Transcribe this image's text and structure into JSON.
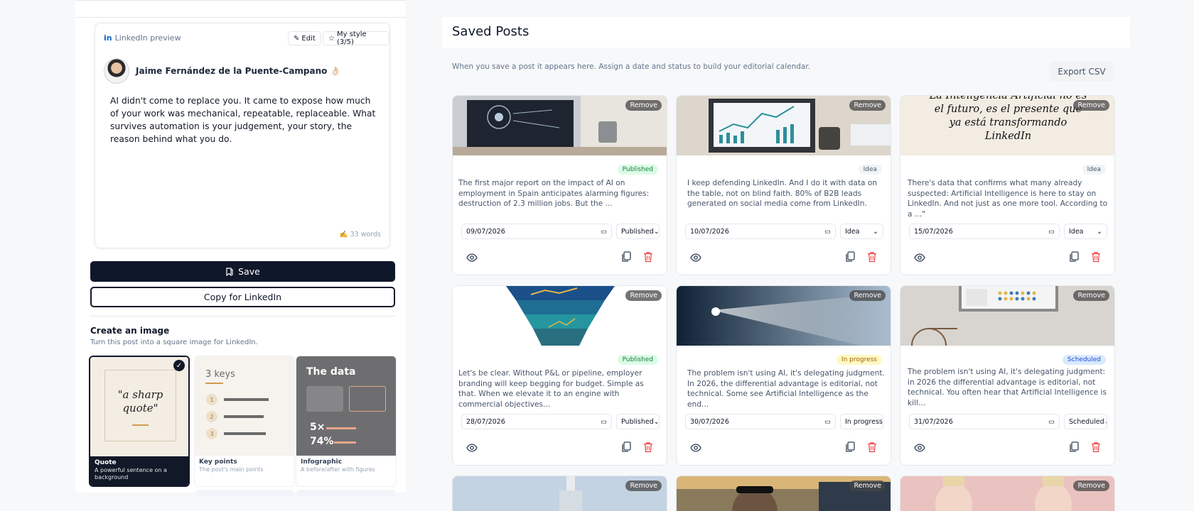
{
  "preview": {
    "header": "LinkedIn preview",
    "edit_label": "Edit",
    "style_label": "My style (3/5)",
    "author": "Jaime Fernández de la Puente-Campano 👌🏻",
    "text": "AI didn't come to replace you. It came to expose how much of your work was mechanical, repeatable, replaceable. What survives automation is your judgement, your story, the reason behind what you do.",
    "words": "✍️ 33 words"
  },
  "actions": {
    "save": "Save",
    "copy": "Copy for LinkedIn"
  },
  "image": {
    "title": "Create an image",
    "subtitle": "Turn this post into a square image for LinkedIn.",
    "templates": [
      {
        "name": "Quote",
        "desc": "A powerful sentence on a background",
        "art_text": "\"a sharp quote\""
      },
      {
        "name": "Key points",
        "desc": "The post's main points",
        "art_text": "3 keys",
        "nums": [
          "1",
          "2",
          "3"
        ]
      },
      {
        "name": "Infographic",
        "desc": "A before/after with figures",
        "art_text": "The data",
        "fig1": "5×",
        "fig2": "74%"
      }
    ]
  },
  "saved": {
    "title": "Saved Posts",
    "description": "When you save a post it appears here. Assign a date and status to build your editorial calendar.",
    "export": "Export CSV",
    "remove_label": "Remove",
    "cards": [
      {
        "status": "Published",
        "status_class": "published",
        "excerpt": "The first major report on the impact of AI on employment in Spain anticipates alarming figures: destruction of 2.3 million jobs. But the ...",
        "date": "09/07/2026",
        "select": "Published"
      },
      {
        "status": "Idea",
        "status_class": "idea",
        "excerpt": "I keep defending LinkedIn. And I do it with data on the table, not on blind faith. 80% of B2B leads generated on social media come from LinkedIn.",
        "date": "10/07/2026",
        "select": "Idea"
      },
      {
        "status": "Idea",
        "status_class": "idea",
        "excerpt": "There's data that confirms what many already suspected: Artificial Intelligence is here to stay on LinkedIn. And not just as one more tool. According to a ...\"",
        "date": "15/07/2026",
        "select": "Idea",
        "image_text": "La Inteligencia Artificial no es el futuro, es el presente que ya está transformando LinkedIn"
      },
      {
        "status": "Published",
        "status_class": "published",
        "excerpt": "Let's be clear. Without P&L or pipeline, employer branding will keep begging for budget. Simple as that. When we elevate it to an engine with commercial objectives...",
        "date": "28/07/2026",
        "select": "Published"
      },
      {
        "status": "In progress",
        "status_class": "progress",
        "excerpt": "The problem isn't using AI, it's delegating judgment. In 2026, the differential advantage is editorial, not technical. Some see Artificial Intelligence as the end...",
        "date": "30/07/2026",
        "select": "In progress"
      },
      {
        "status": "Scheduled",
        "status_class": "scheduled",
        "excerpt": "The problem isn't using AI, it's delegating judgment: in 2026 the differential advantage is editorial, not technical. You often hear that Artificial Intelligence is kill...",
        "date": "31/07/2026",
        "select": "Scheduled"
      }
    ]
  },
  "colors": {
    "primary": "#0f172a",
    "danger": "#ef4444",
    "linkedin": "#0a66c2"
  }
}
